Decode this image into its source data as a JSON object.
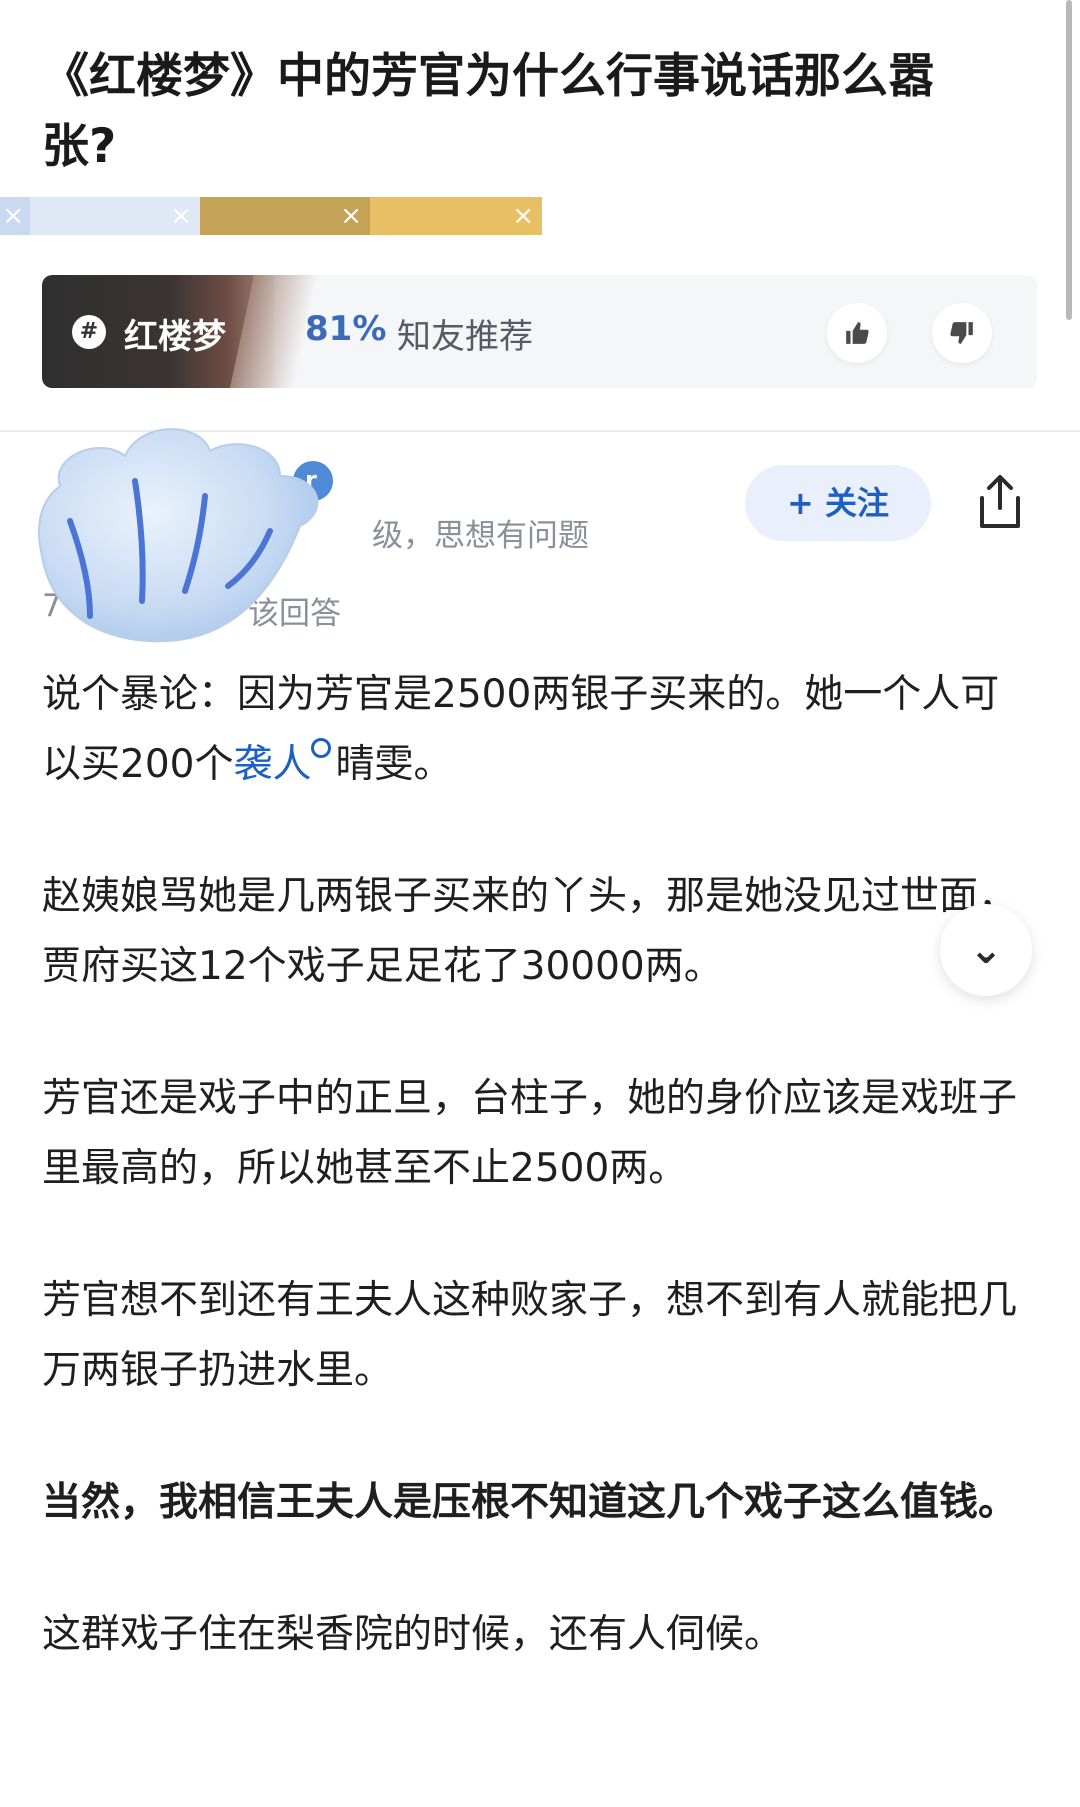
{
  "question": {
    "title": "《红楼梦》中的芳官为什么行事说话那么嚣张?"
  },
  "tag_strip": {
    "segments": [
      {
        "color": "#c9d9ef",
        "width": 30
      },
      {
        "color": "#dfe8f4",
        "width": 170
      },
      {
        "color": "#c4a257",
        "width": 170
      },
      {
        "color": "#e8bf62",
        "width": 172
      }
    ],
    "close_glyph": "×"
  },
  "topic": {
    "hash_glyph": "#",
    "name": "红楼梦",
    "percent": "81%",
    "rec_label": "知友推荐",
    "thumb_up_icon": "thumb-up-icon",
    "thumb_down_icon": "thumb-down-icon"
  },
  "author": {
    "meta_suffix": "级，思想有问题",
    "answer_note_prefix": "7",
    "answer_note_suffix": "该回答",
    "badge_glyph": "r",
    "follow_label": "+ 关注",
    "share_icon": "share-icon"
  },
  "answer": {
    "paragraphs": [
      {
        "pre": "说个暴论：因为芳官是2500两银子买来的。她一个人可以买200个",
        "link": "袭人",
        "post": "晴雯。",
        "bold": false
      },
      {
        "text": "赵姨娘骂她是几两银子买来的丫头，那是她没见过世面，贾府买这12个戏子足足花了30000两。",
        "bold": false
      },
      {
        "text": "芳官还是戏子中的正旦，台柱子，她的身价应该是戏班子里最高的，所以她甚至不止2500两。",
        "bold": false
      },
      {
        "text": "芳官想不到还有王夫人这种败家子，想不到有人就能把几万两银子扔进水里。",
        "bold": false
      },
      {
        "text": "当然，我相信王夫人是压根不知道这几个戏子这么值钱。",
        "bold": true
      },
      {
        "text": "这群戏子住在梨香院的时候，还有人伺候。",
        "bold": false
      }
    ],
    "expand_glyph": "⌄"
  }
}
